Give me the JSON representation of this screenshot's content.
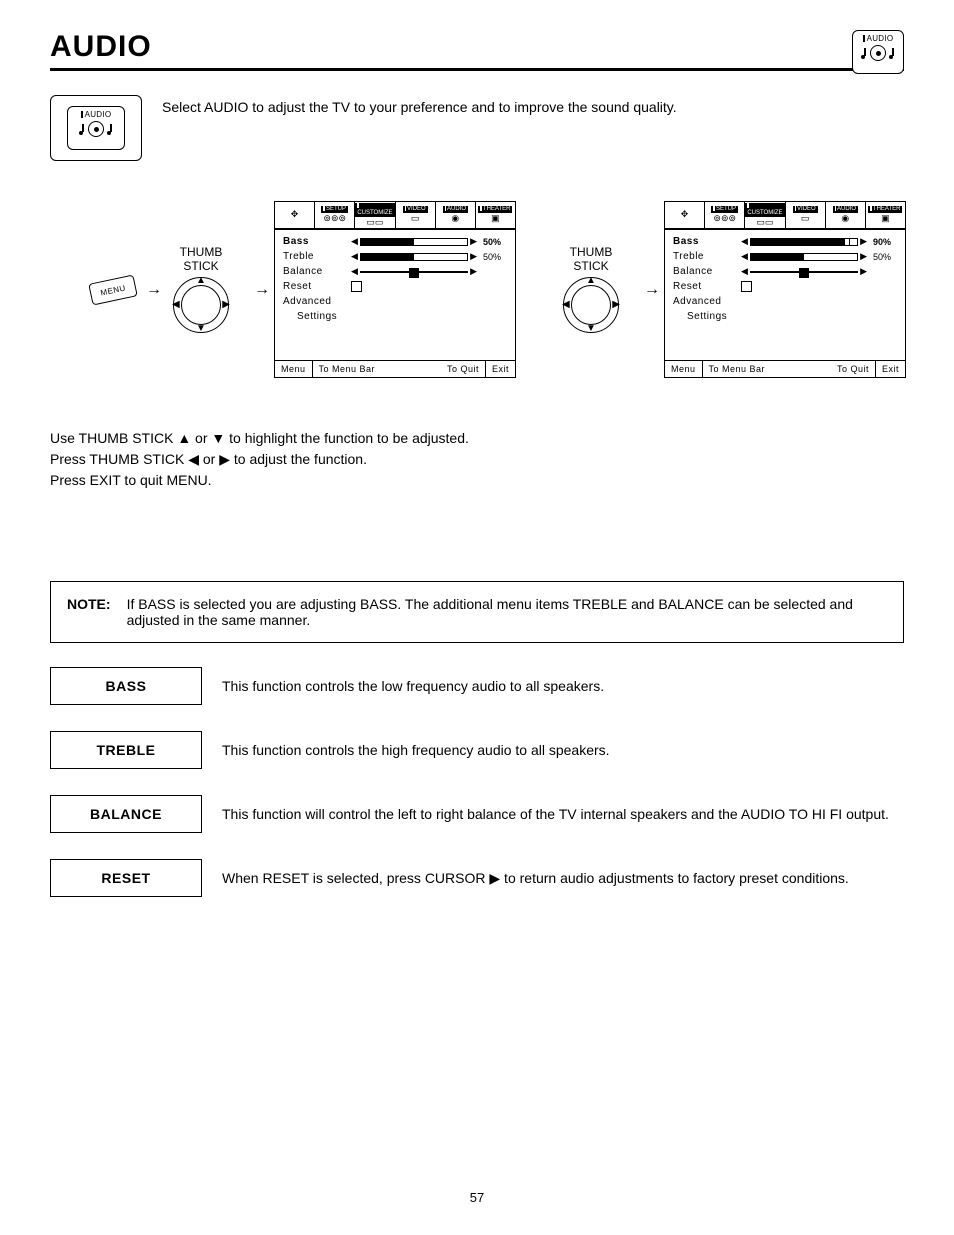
{
  "page_number": "57",
  "header": {
    "title": "AUDIO",
    "corner_badge_label": "AUDIO"
  },
  "intro": {
    "badge_label": "AUDIO",
    "text": "Select AUDIO to adjust the TV to your preference and to improve the sound quality."
  },
  "osd": {
    "tabs": [
      "SETUP",
      "CUSTOMIZE",
      "VIDEO",
      "AUDIO",
      "THEATER"
    ],
    "items": {
      "bass": "Bass",
      "treble": "Treble",
      "balance": "Balance",
      "reset": "Reset",
      "advanced": "Advanced",
      "settings": "Settings"
    },
    "footer": {
      "menu": "Menu",
      "to_menu_bar": "To Menu Bar",
      "to_quit": "To Quit",
      "exit": "Exit"
    }
  },
  "diagram": {
    "menu_button": "MENU",
    "thumb_stick_line1": "THUMB",
    "thumb_stick_line2": "STICK",
    "screen1": {
      "bass_val": "50%",
      "treble_val": "50%",
      "bass_fill": 50,
      "bass_bold": true
    },
    "screen2": {
      "bass_val": "90%",
      "treble_val": "50%",
      "bass_fill": 90,
      "bass_bold": true
    }
  },
  "instructions": {
    "line1_a": "Use THUMB STICK ",
    "line1_b": " or ",
    "line1_c": " to highlight the function to be adjusted.",
    "line2_a": "Press THUMB STICK ",
    "line2_b": " or ",
    "line2_c": " to adjust the function.",
    "line3": "Press EXIT to quit MENU.",
    "up": "▲",
    "down": "▼",
    "left": "◀",
    "right": "▶"
  },
  "note": {
    "label": "NOTE:",
    "text": "If BASS is selected you are adjusting BASS.  The additional menu items TREBLE and BALANCE can be selected and adjusted in the same manner."
  },
  "functions": {
    "bass": {
      "label": "BASS",
      "desc": "This function controls the low frequency audio to all speakers."
    },
    "treble": {
      "label": "TREBLE",
      "desc": "This function controls the high frequency audio to all speakers."
    },
    "balance": {
      "label": "BALANCE",
      "desc": "This function will control the left to right balance of the TV internal speakers and the AUDIO TO HI FI output."
    },
    "reset": {
      "label": "RESET",
      "desc_a": "When RESET is selected, press CURSOR ",
      "desc_b": " to return audio adjustments to factory preset conditions.",
      "arrow": "▶"
    }
  }
}
